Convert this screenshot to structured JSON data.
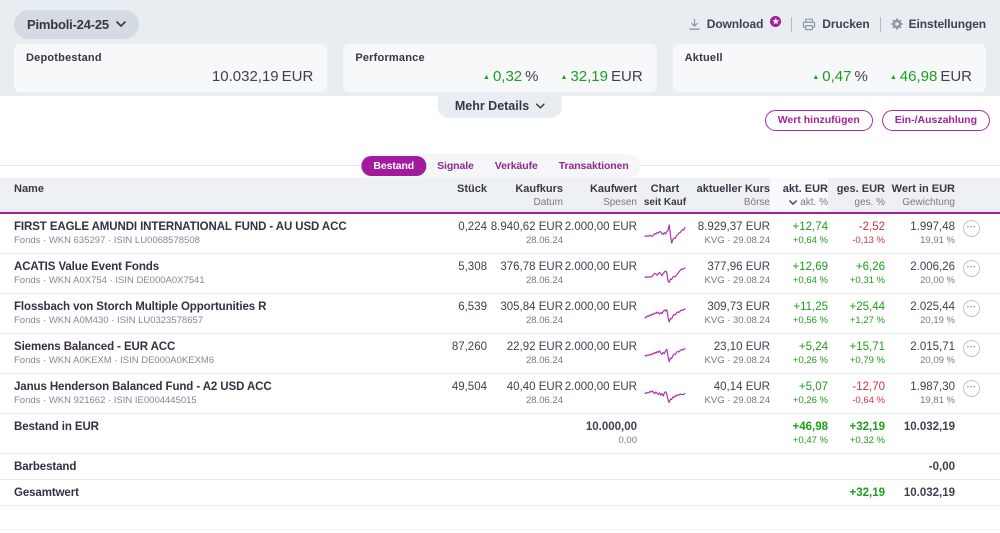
{
  "colors": {
    "magenta": "#a81a9c",
    "magenta_tab": "#a21a9e",
    "green": "#1f9d1f",
    "red": "#d4333f",
    "band_bg": "#e8edf2",
    "card_bg": "#f6f8fa",
    "header_bg": "#eef1f4"
  },
  "header": {
    "portfolio_name": "Pimboli-24-25",
    "actions": [
      {
        "label": "Download",
        "icon": "download-icon",
        "badge_icon": "premium-star-badge"
      },
      {
        "label": "Drucken",
        "icon": "printer-icon"
      },
      {
        "label": "Einstellungen",
        "icon": "gear-icon"
      }
    ]
  },
  "summary_cards": [
    {
      "label": "Depotbestand",
      "values": [
        {
          "num": "10.032,19",
          "unit": "EUR"
        }
      ]
    },
    {
      "label": "Performance",
      "values": [
        {
          "arrow": "up",
          "num": "0,32",
          "unit": "%"
        },
        {
          "arrow": "up",
          "num": "32,19",
          "unit": "EUR"
        }
      ]
    },
    {
      "label": "Aktuell",
      "values": [
        {
          "arrow": "up",
          "num": "0,47",
          "unit": "%"
        },
        {
          "arrow": "up",
          "num": "46,98",
          "unit": "EUR"
        }
      ]
    }
  ],
  "mehr_details": {
    "label": "Mehr Details"
  },
  "action_buttons": [
    {
      "label": "Wert hinzufügen"
    },
    {
      "label": "Ein-/Auszahlung"
    }
  ],
  "tabs": [
    {
      "label": "Bestand",
      "active": true
    },
    {
      "label": "Signale",
      "active": false
    },
    {
      "label": "Verkäufe",
      "active": false
    },
    {
      "label": "Transaktionen",
      "active": false
    }
  ],
  "table": {
    "columns": [
      {
        "id": "name",
        "line1": "Name",
        "line2": ""
      },
      {
        "id": "stueck",
        "line1": "Stück",
        "line2": ""
      },
      {
        "id": "kaufkurs",
        "line1": "Kaufkurs",
        "line2": "Datum"
      },
      {
        "id": "kaufwert",
        "line1": "Kaufwert",
        "line2": "Spesen"
      },
      {
        "id": "chart",
        "line1": "Chart",
        "line2": "seit Kauf",
        "line2_dark": true
      },
      {
        "id": "kurs",
        "line1": "aktueller Kurs",
        "line2": "Börse"
      },
      {
        "id": "akt",
        "line1": "akt. EUR",
        "line2": "akt. %",
        "sorted": "desc"
      },
      {
        "id": "ges",
        "line1": "ges. EUR",
        "line2": "ges. %"
      },
      {
        "id": "wert",
        "line1": "Wert in EUR",
        "line2": "Gewichtung"
      }
    ],
    "rows": [
      {
        "name": "FIRST EAGLE AMUNDI INTERNATIONAL FUND - AU USD ACC",
        "sub": "Fonds · WKN 635297 · ISIN LU0068578508",
        "stueck": "0,224",
        "kaufkurs": "8.940,62 EUR",
        "kauf_datum": "28.06.24",
        "kaufwert": "2.000,00 EUR",
        "spesen": "",
        "spark": [
          0.4,
          0.38,
          0.41,
          0.39,
          0.43,
          0.41,
          0.38,
          0.45,
          0.52,
          0.5,
          0.57,
          0.55,
          0.62,
          0.6,
          0.52,
          0.48,
          0.57,
          0.5,
          0.62,
          0.68,
          0.95,
          0.42,
          0.05,
          0.22,
          0.3,
          0.28,
          0.4,
          0.47,
          0.55,
          0.57,
          0.65,
          0.72,
          0.7,
          0.82
        ],
        "kurs": "8.929,37 EUR",
        "boerse": "KVG · 29.08.24",
        "akt_eur": "+12,74",
        "akt_pct": "+0,64 %",
        "akt_dir": "pos",
        "ges_eur": "-2,52",
        "ges_pct": "-0,13 %",
        "ges_dir": "neg",
        "wert": "1.997,48",
        "gewichtung": "19,91 %"
      },
      {
        "name": "ACATIS Value Event Fonds",
        "sub": "Fonds · WKN A0X754 · ISIN DE000A0X7541",
        "stueck": "5,308",
        "kaufkurs": "376,78 EUR",
        "kauf_datum": "28.06.24",
        "kaufwert": "2.000,00 EUR",
        "spesen": "",
        "spark": [
          0.35,
          0.33,
          0.36,
          0.34,
          0.37,
          0.35,
          0.4,
          0.47,
          0.53,
          0.5,
          0.44,
          0.52,
          0.58,
          0.5,
          0.42,
          0.52,
          0.6,
          0.65,
          0.58,
          0.15,
          0.08,
          0.25,
          0.23,
          0.35,
          0.38,
          0.36,
          0.45,
          0.52,
          0.6,
          0.68,
          0.75,
          0.73,
          0.78,
          0.8
        ],
        "kurs": "377,96 EUR",
        "boerse": "KVG · 29.08.24",
        "akt_eur": "+12,69",
        "akt_pct": "+0,64 %",
        "akt_dir": "pos",
        "ges_eur": "+6,26",
        "ges_pct": "+0,31 %",
        "ges_dir": "pos",
        "wert": "2.006,26",
        "gewichtung": "20,00 %"
      },
      {
        "name": "Flossbach von Storch Multiple Opportunities R",
        "sub": "Fonds · WKN A0M430 · ISIN LU0323578657",
        "stueck": "6,539",
        "kaufkurs": "305,84 EUR",
        "kauf_datum": "28.06.24",
        "kaufwert": "2.000,00 EUR",
        "spesen": "",
        "spark": [
          0.3,
          0.35,
          0.4,
          0.38,
          0.45,
          0.43,
          0.5,
          0.48,
          0.55,
          0.52,
          0.6,
          0.55,
          0.5,
          0.58,
          0.52,
          0.62,
          0.7,
          0.65,
          0.72,
          0.35,
          0.1,
          0.28,
          0.26,
          0.4,
          0.48,
          0.46,
          0.55,
          0.6,
          0.58,
          0.65,
          0.7,
          0.68,
          0.73,
          0.75
        ],
        "kurs": "309,73 EUR",
        "boerse": "KVG · 30.08.24",
        "akt_eur": "+11,25",
        "akt_pct": "+0,56 %",
        "akt_dir": "pos",
        "ges_eur": "+25,44",
        "ges_pct": "+1,27 %",
        "ges_dir": "pos",
        "wert": "2.025,44",
        "gewichtung": "20,19 %"
      },
      {
        "name": "Siemens Balanced - EUR ACC",
        "sub": "Fonds · WKN A0KEXM · ISIN DE000A0KEXM6",
        "stueck": "87,260",
        "kaufkurs": "22,92 EUR",
        "kauf_datum": "28.06.24",
        "kaufwert": "2.000,00 EUR",
        "spesen": "",
        "spark": [
          0.42,
          0.4,
          0.45,
          0.43,
          0.48,
          0.46,
          0.52,
          0.5,
          0.58,
          0.54,
          0.62,
          0.58,
          0.66,
          0.55,
          0.48,
          0.58,
          0.52,
          0.66,
          0.74,
          0.4,
          0.12,
          0.3,
          0.28,
          0.42,
          0.5,
          0.48,
          0.58,
          0.63,
          0.6,
          0.67,
          0.72,
          0.7,
          0.74,
          0.77
        ],
        "kurs": "23,10 EUR",
        "boerse": "KVG · 29.08.24",
        "akt_eur": "+5,24",
        "akt_pct": "+0,26 %",
        "akt_dir": "pos",
        "ges_eur": "+15,71",
        "ges_pct": "+0,79 %",
        "ges_dir": "pos",
        "wert": "2.015,71",
        "gewichtung": "20,09 %"
      },
      {
        "name": "Janus Henderson Balanced Fund - A2 USD ACC",
        "sub": "Fonds · WKN 921662 · ISIN IE0004445015",
        "stueck": "49,504",
        "kaufkurs": "40,40 EUR",
        "kauf_datum": "28.06.24",
        "kaufwert": "2.000,00 EUR",
        "spesen": "",
        "spark": [
          0.55,
          0.53,
          0.58,
          0.56,
          0.62,
          0.6,
          0.66,
          0.58,
          0.52,
          0.6,
          0.54,
          0.48,
          0.56,
          0.44,
          0.52,
          0.4,
          0.55,
          0.62,
          0.5,
          0.2,
          0.08,
          0.25,
          0.23,
          0.35,
          0.33,
          0.42,
          0.4,
          0.46,
          0.44,
          0.5,
          0.48,
          0.46,
          0.5,
          0.52
        ],
        "kurs": "40,14 EUR",
        "boerse": "KVG · 29.08.24",
        "akt_eur": "+5,07",
        "akt_pct": "+0,26 %",
        "akt_dir": "pos",
        "ges_eur": "-12,70",
        "ges_pct": "-0,64 %",
        "ges_dir": "neg",
        "wert": "1.987,30",
        "gewichtung": "19,81 %"
      }
    ],
    "summary_rows": [
      {
        "label": "Bestand in EUR",
        "size": "lg",
        "kaufwert": "10.000,00",
        "spesen": "0,00",
        "akt_eur": "+46,98",
        "akt_pct": "+0,47 %",
        "akt_dir": "pos",
        "ges_eur": "+32,19",
        "ges_pct": "+0,32 %",
        "ges_dir": "pos",
        "wert": "10.032,19"
      },
      {
        "label": "Barbestand",
        "size": "sm",
        "wert": "-0,00"
      },
      {
        "label": "Gesamtwert",
        "size": "sm",
        "ges_eur": "+32,19",
        "ges_dir": "pos",
        "wert": "10.032,19"
      }
    ]
  }
}
